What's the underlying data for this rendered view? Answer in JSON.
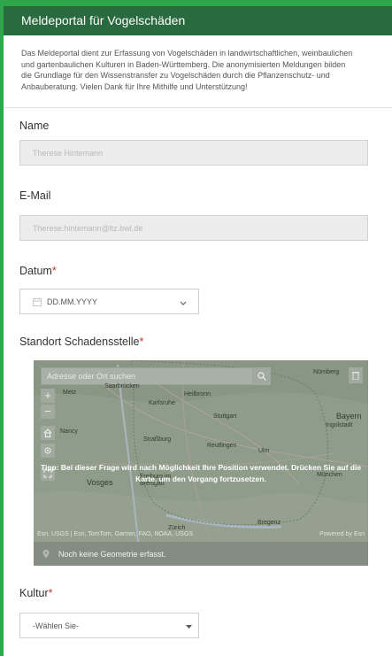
{
  "header": {
    "title": "Meldeportal für Vogelschäden"
  },
  "intro": {
    "lines": [
      "Das Meldeportal dient zur Erfassung von Vogelschäden in landwirtschaftlichen, weinbaulichen",
      "und gartenbaulichen Kulturen in Baden-Württemberg. Die anonymisierten Meldungen bilden",
      "die Grundlage für den Wissenstransfer zu Vogelschäden durch die Pflanzenschutz- und",
      "Anbauberatung. Vielen Dank für Ihre Mithilfe und Unterstützung!"
    ]
  },
  "form": {
    "name": {
      "label": "Name",
      "value": "Therese Hintemann"
    },
    "email": {
      "label": "E-Mail",
      "value": "Therese.hintemann@ltz.bwl.de"
    },
    "datum": {
      "label": "Datum",
      "required_mark": "*",
      "placeholder": "DD.MM.YYYY"
    },
    "standort": {
      "label": "Standort Schadensstelle",
      "required_mark": "*"
    },
    "kultur": {
      "label": "Kultur",
      "required_mark": "*",
      "selected": "-Wählen Sie-"
    }
  },
  "map": {
    "search_placeholder": "Adresse oder Ort suchen",
    "cities": [
      "Saarbrücken",
      "Metz",
      "Heilbronn",
      "Nürnberg",
      "Karlsruhe",
      "Stuttgart",
      "Nancy",
      "Bayern",
      "Ingolstadt",
      "Straßburg",
      "Reutlingen",
      "Ulm",
      "Vosges",
      "Freiburg im Breisgau",
      "München",
      "Bregenz",
      "Zürich"
    ],
    "tip": "Tipp: Bei dieser Frage wird nach Möglichkeit Ihre Position verwendet. Drücken Sie auf die Karte, um den Vorgang fortzusetzen.",
    "attribution": "Esri, USGS | Esri, TomTom, Garmin, FAO, NOAA, USGS",
    "powered_by": "Powered by Esri",
    "geometry_status": "Noch keine Geometrie erfasst."
  },
  "colors": {
    "header_bg": "#2a6a3f",
    "accent_border": "#2fa64a",
    "required": "#c0392b"
  }
}
